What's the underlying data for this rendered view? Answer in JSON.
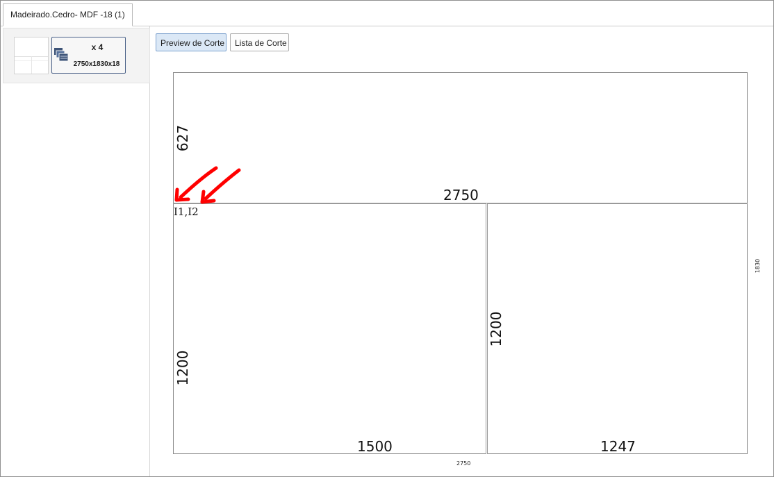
{
  "tab": {
    "title": "Madeirado.Cedro- MDF -18 (1)"
  },
  "sheet_list": {
    "items": [
      {
        "quantity": "x 4",
        "dimensions": "2750x1830x18",
        "icon": "stacked-sheets-icon"
      }
    ]
  },
  "toolbar": {
    "preview_label": "Preview de Corte",
    "list_label": "Lista de Corte",
    "active": "preview"
  },
  "cut_plan": {
    "sheet_width_label": "2750",
    "sheet_height_label": "1830",
    "pieces": [
      {
        "width_label": "2750",
        "height_label": "627"
      },
      {
        "width_label": "1500",
        "height_label": "1200"
      },
      {
        "width_label": "1247",
        "height_label": "1200"
      }
    ],
    "offcut_label": "I1,I2",
    "annotation_color": "#ff0000"
  }
}
